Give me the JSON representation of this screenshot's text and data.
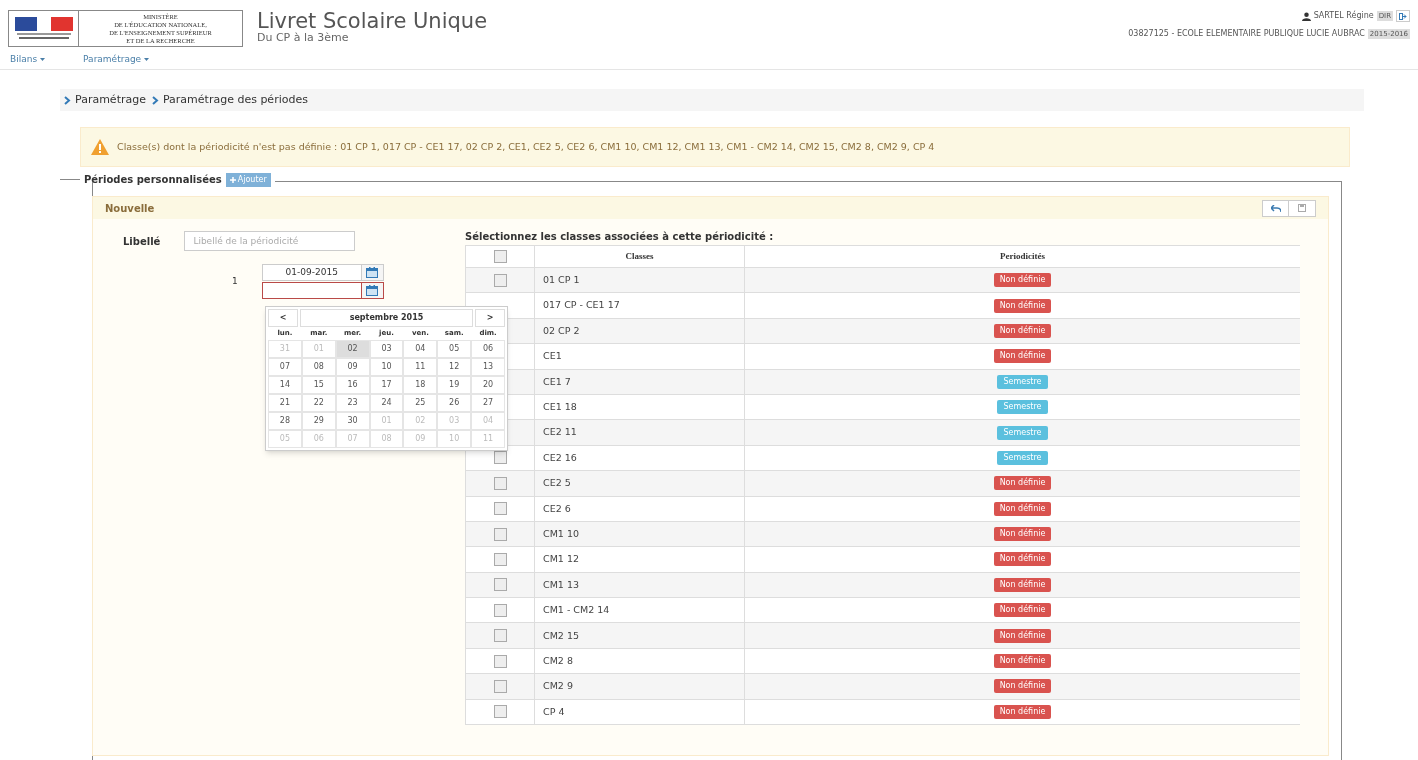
{
  "header": {
    "logo": {
      "ministry": [
        "MINISTÈRE",
        "DE L'ÉDUCATION NATIONALE,",
        "DE L'ENSEIGNEMENT SUPÉRIEUR",
        "ET DE LA RECHERCHE"
      ]
    },
    "title": "Livret Scolaire Unique",
    "subtitle": "Du CP à la 3ème",
    "user": "SARTEL Régine",
    "role": "DIR",
    "school": "03827125 - ECOLE ELEMENTAIRE PUBLIQUE LUCIE AUBRAC",
    "year": "2015-2016"
  },
  "nav": [
    "Bilans",
    "Paramétrage"
  ],
  "breadcrumb": [
    "Paramétrage",
    "Paramétrage des périodes"
  ],
  "alert": "Classe(s) dont la périodicité n'est pas définie : 01 CP 1, 017 CP - CE1 17, 02 CP 2, CE1, CE2 5, CE2 6, CM1 10, CM1 12, CM1 13, CM1 - CM2 14, CM2 15, CM2 8, CM2 9, CP 4",
  "section": {
    "legend": "Périodes personnalisées",
    "add_button": "Ajouter"
  },
  "panel": {
    "title": "Nouvelle",
    "label": "Libellé",
    "placeholder": "Libellé de la périodicité",
    "period_number": "1",
    "start_date": "01-09-2015",
    "end_date_invalid": true,
    "calendar": {
      "month": "septembre 2015",
      "prev": "<",
      "next": ">",
      "weekdays": [
        "lun.",
        "mar.",
        "mer.",
        "jeu.",
        "ven.",
        "sam.",
        "dim."
      ],
      "weeks": [
        [
          {
            "label": "31",
            "muted": true,
            "selected": false
          },
          {
            "label": "01",
            "muted": true,
            "selected": false
          },
          {
            "label": "02",
            "muted": false,
            "selected": true
          },
          {
            "label": "03",
            "muted": false,
            "selected": false
          },
          {
            "label": "04",
            "muted": false,
            "selected": false
          },
          {
            "label": "05",
            "muted": false,
            "selected": false
          },
          {
            "label": "06",
            "muted": false,
            "selected": false
          }
        ],
        [
          {
            "label": "07",
            "muted": false,
            "selected": false
          },
          {
            "label": "08",
            "muted": false,
            "selected": false
          },
          {
            "label": "09",
            "muted": false,
            "selected": false
          },
          {
            "label": "10",
            "muted": false,
            "selected": false
          },
          {
            "label": "11",
            "muted": false,
            "selected": false
          },
          {
            "label": "12",
            "muted": false,
            "selected": false
          },
          {
            "label": "13",
            "muted": false,
            "selected": false
          }
        ],
        [
          {
            "label": "14",
            "muted": false,
            "selected": false
          },
          {
            "label": "15",
            "muted": false,
            "selected": false
          },
          {
            "label": "16",
            "muted": false,
            "selected": false
          },
          {
            "label": "17",
            "muted": false,
            "selected": false
          },
          {
            "label": "18",
            "muted": false,
            "selected": false
          },
          {
            "label": "19",
            "muted": false,
            "selected": false
          },
          {
            "label": "20",
            "muted": false,
            "selected": false
          }
        ],
        [
          {
            "label": "21",
            "muted": false,
            "selected": false
          },
          {
            "label": "22",
            "muted": false,
            "selected": false
          },
          {
            "label": "23",
            "muted": false,
            "selected": false
          },
          {
            "label": "24",
            "muted": false,
            "selected": false
          },
          {
            "label": "25",
            "muted": false,
            "selected": false
          },
          {
            "label": "26",
            "muted": false,
            "selected": false
          },
          {
            "label": "27",
            "muted": false,
            "selected": false
          }
        ],
        [
          {
            "label": "28",
            "muted": false,
            "selected": false
          },
          {
            "label": "29",
            "muted": false,
            "selected": false
          },
          {
            "label": "30",
            "muted": false,
            "selected": false
          },
          {
            "label": "01",
            "muted": true,
            "selected": false
          },
          {
            "label": "02",
            "muted": true,
            "selected": false
          },
          {
            "label": "03",
            "muted": true,
            "selected": false
          },
          {
            "label": "04",
            "muted": true,
            "selected": false
          }
        ],
        [
          {
            "label": "05",
            "muted": true,
            "selected": false
          },
          {
            "label": "06",
            "muted": true,
            "selected": false
          },
          {
            "label": "07",
            "muted": true,
            "selected": false
          },
          {
            "label": "08",
            "muted": true,
            "selected": false
          },
          {
            "label": "09",
            "muted": true,
            "selected": false
          },
          {
            "label": "10",
            "muted": true,
            "selected": false
          },
          {
            "label": "11",
            "muted": true,
            "selected": false
          }
        ]
      ]
    }
  },
  "table": {
    "title": "Sélectionnez les classes associées à cette périodicité :",
    "columns": [
      "Classes",
      "Periodicités"
    ],
    "header_checked": false,
    "rows": [
      {
        "checked": false,
        "name": "01 CP 1",
        "status": "Non définie",
        "kind": "undefined"
      },
      {
        "name": "017 CP - CE1 17",
        "status": "Non définie",
        "kind": "undefined"
      },
      {
        "name": "02 CP 2",
        "status": "Non définie",
        "kind": "undefined"
      },
      {
        "name": "CE1",
        "status": "Non définie",
        "kind": "undefined"
      },
      {
        "name": "CE1 7",
        "status": "Semestre",
        "kind": "defined"
      },
      {
        "name": "CE1 18",
        "status": "Semestre",
        "kind": "defined"
      },
      {
        "name": "CE2 11",
        "status": "Semestre",
        "kind": "defined"
      },
      {
        "checked": false,
        "name": "CE2 16",
        "status": "Semestre",
        "kind": "defined"
      },
      {
        "checked": false,
        "name": "CE2 5",
        "status": "Non définie",
        "kind": "undefined"
      },
      {
        "checked": false,
        "name": "CE2 6",
        "status": "Non définie",
        "kind": "undefined"
      },
      {
        "checked": false,
        "name": "CM1 10",
        "status": "Non définie",
        "kind": "undefined"
      },
      {
        "checked": false,
        "name": "CM1 12",
        "status": "Non définie",
        "kind": "undefined"
      },
      {
        "checked": false,
        "name": "CM1 13",
        "status": "Non définie",
        "kind": "undefined"
      },
      {
        "checked": false,
        "name": "CM1 - CM2 14",
        "status": "Non définie",
        "kind": "undefined"
      },
      {
        "checked": false,
        "name": "CM2 15",
        "status": "Non définie",
        "kind": "undefined"
      },
      {
        "checked": false,
        "name": "CM2 8",
        "status": "Non définie",
        "kind": "undefined"
      },
      {
        "checked": false,
        "name": "CM2 9",
        "status": "Non définie",
        "kind": "undefined"
      },
      {
        "checked": false,
        "name": "CP 4",
        "status": "Non définie",
        "kind": "undefined"
      }
    ]
  }
}
